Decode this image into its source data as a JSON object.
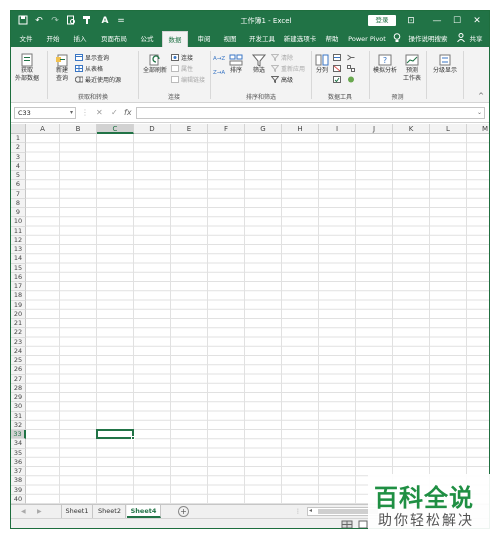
{
  "colors": {
    "brand": "#217346",
    "ribbon_bg": "#f3f3f3",
    "grid_line": "#e1e1e1",
    "watermark_green": "#1f8f43"
  },
  "titlebar": {
    "title": "工作簿1 - Excel",
    "signin_label": "登录",
    "icons": [
      "save-icon",
      "undo-icon",
      "redo-icon",
      "print-preview-icon",
      "format-painter-icon",
      "font-color-icon",
      "customize-icon"
    ],
    "window_buttons": {
      "ribbon_options": "⊡",
      "minimize": "—",
      "restore": "☐",
      "close": "✕"
    }
  },
  "tabs": [
    {
      "label": "文件"
    },
    {
      "label": "开始"
    },
    {
      "label": "插入"
    },
    {
      "label": "页面布局"
    },
    {
      "label": "公式"
    },
    {
      "label": "数据"
    },
    {
      "label": "审阅"
    },
    {
      "label": "视图"
    },
    {
      "label": "开发工具"
    },
    {
      "label": "新建选项卡"
    },
    {
      "label": "帮助"
    },
    {
      "label": "Power Pivot"
    }
  ],
  "tell_me": {
    "label": "操作说明搜索",
    "icon": "lightbulb-icon"
  },
  "share": {
    "label": "共享",
    "icon": "person-icon"
  },
  "ribbon": {
    "get_data": {
      "line1": "获取",
      "line2": "外部数据"
    },
    "new_query": {
      "line1": "新建",
      "line2": "查询"
    },
    "show_queries": "显示查询",
    "from_table": "从表格",
    "recent_sources": "最近使用的源",
    "group_get_transform": "获取和转换",
    "refresh_all": "全部刷新",
    "connections": "连接",
    "properties": "属性",
    "edit_links": "编辑链接",
    "group_connections": "连接",
    "sort_az": "A→Z",
    "sort_za": "Z→A",
    "sort": "排序",
    "filter": "筛选",
    "clear": "清除",
    "reapply": "重新应用",
    "advanced": "高级",
    "group_sort_filter": "排序和筛选",
    "text_to_columns": "分列",
    "group_data_tools": "数据工具",
    "what_if": "模拟分析",
    "forecast_sheet": {
      "line1": "预测",
      "line2": "工作表"
    },
    "group_forecast": "预测",
    "outline": "分级显示",
    "collapse_glyph": "^"
  },
  "formula_bar": {
    "name_box": "C33",
    "cancel": "✕",
    "enter": "✓",
    "fx": "fx",
    "value": ""
  },
  "grid": {
    "columns": [
      "A",
      "B",
      "C",
      "D",
      "E",
      "F",
      "G",
      "H",
      "I",
      "J",
      "K",
      "L",
      "M"
    ],
    "rows": [
      "1",
      "2",
      "3",
      "4",
      "5",
      "6",
      "7",
      "8",
      "9",
      "10",
      "11",
      "12",
      "13",
      "14",
      "15",
      "16",
      "17",
      "18",
      "19",
      "20",
      "21",
      "22",
      "23",
      "24",
      "25",
      "26",
      "27",
      "28",
      "29",
      "30",
      "31",
      "32",
      "33",
      "34",
      "35",
      "36",
      "37",
      "38",
      "39",
      "40"
    ],
    "selected_column": "C",
    "selected_row": "33"
  },
  "sheets": [
    {
      "label": "Sheet1"
    },
    {
      "label": "Sheet2"
    },
    {
      "label": "Sheet4"
    }
  ],
  "active_sheet": "Sheet4",
  "add_sheet": "+",
  "watermark": {
    "big": "百科全说",
    "small": "助你轻松解决"
  }
}
